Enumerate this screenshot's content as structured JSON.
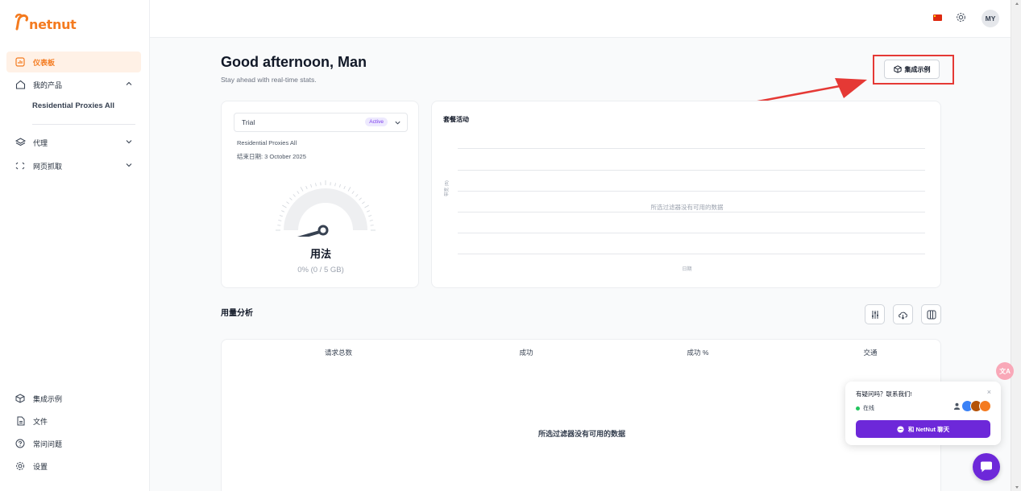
{
  "brand": {
    "logo_text": "netnut"
  },
  "sidebar": {
    "items": [
      {
        "label": "仪表板",
        "icon": "chart-icon"
      },
      {
        "label": "我的产品",
        "icon": "home-icon"
      },
      {
        "label": "代理",
        "icon": "layers-icon"
      },
      {
        "label": "网页抓取",
        "icon": "scan-icon"
      }
    ],
    "sub_item": "Residential Proxies All",
    "bottom": [
      {
        "label": "集成示例",
        "icon": "cube-icon"
      },
      {
        "label": "文件",
        "icon": "file-icon"
      },
      {
        "label": "常问问题",
        "icon": "help-icon"
      },
      {
        "label": "设置",
        "icon": "gear-icon"
      }
    ]
  },
  "topbar": {
    "avatar": "MY",
    "flag": "china-flag-icon"
  },
  "header": {
    "greeting": "Good afternoon, Man",
    "subtitle": "Stay ahead with real-time stats.",
    "integration_button": "集成示例"
  },
  "plan": {
    "name": "Trial",
    "status": "Active",
    "product": "Residential Proxies All",
    "end_date": "结束日期: 3 October 2025",
    "usage_title": "用法",
    "usage_value": "0% (0 / 5 GB)",
    "usage_fraction": 0
  },
  "activity": {
    "title": "套餐活动",
    "ylabel": "带宽 (B)",
    "xlabel": "日期",
    "empty": "所选过滤器没有可用的数据"
  },
  "analysis": {
    "title": "用量分析",
    "columns": [
      "请求总数",
      "成功",
      "成功 %",
      "交通"
    ],
    "empty": "所选过滤器没有可用的数据"
  },
  "chat": {
    "question": "有疑问吗？联系我们!",
    "close": "×",
    "online": "在线",
    "button": "和 NetNut 聊天",
    "translate": "文A"
  },
  "colors": {
    "accent": "#f47b20",
    "purple": "#6d28d9",
    "highlight": "#e53935"
  }
}
